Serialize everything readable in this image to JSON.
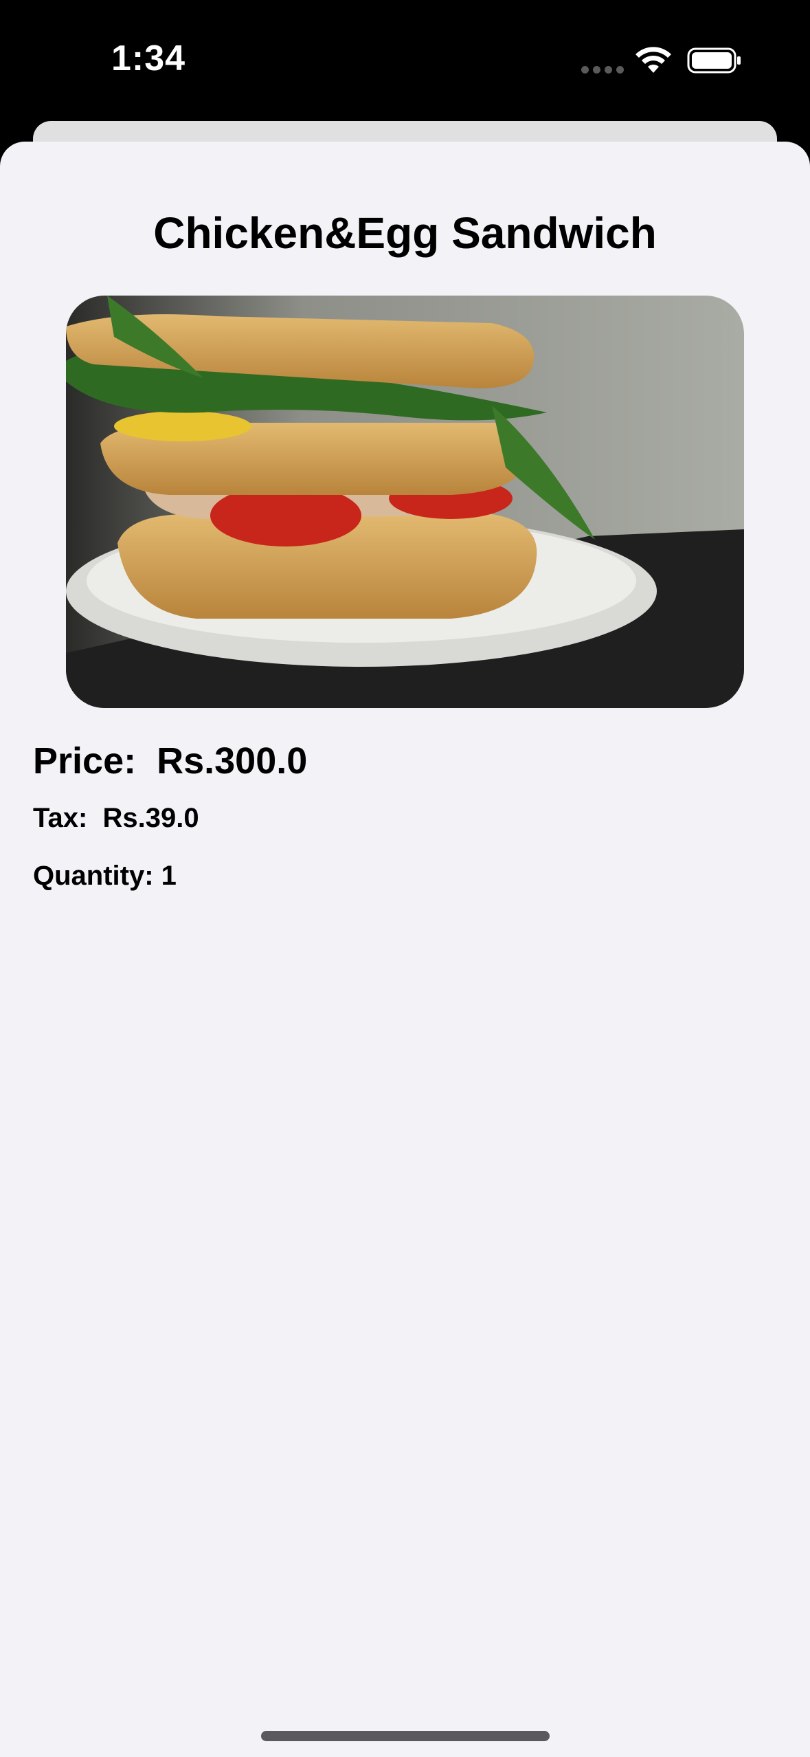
{
  "status_bar": {
    "time": "1:34",
    "icons": [
      "cellular-dots-icon",
      "wifi-icon",
      "battery-icon"
    ]
  },
  "item": {
    "title": "Chicken&Egg Sandwich",
    "image_description": "sandwich-photo",
    "price_label": "Price:",
    "price_value": "Rs.300.0",
    "tax_label": "Tax:",
    "tax_value": "Rs.39.0",
    "quantity_label": "Quantity:",
    "quantity_value": "1"
  },
  "colors": {
    "sheet_background": "#f2f2f7",
    "status_background": "#000000",
    "text": "#000000"
  }
}
